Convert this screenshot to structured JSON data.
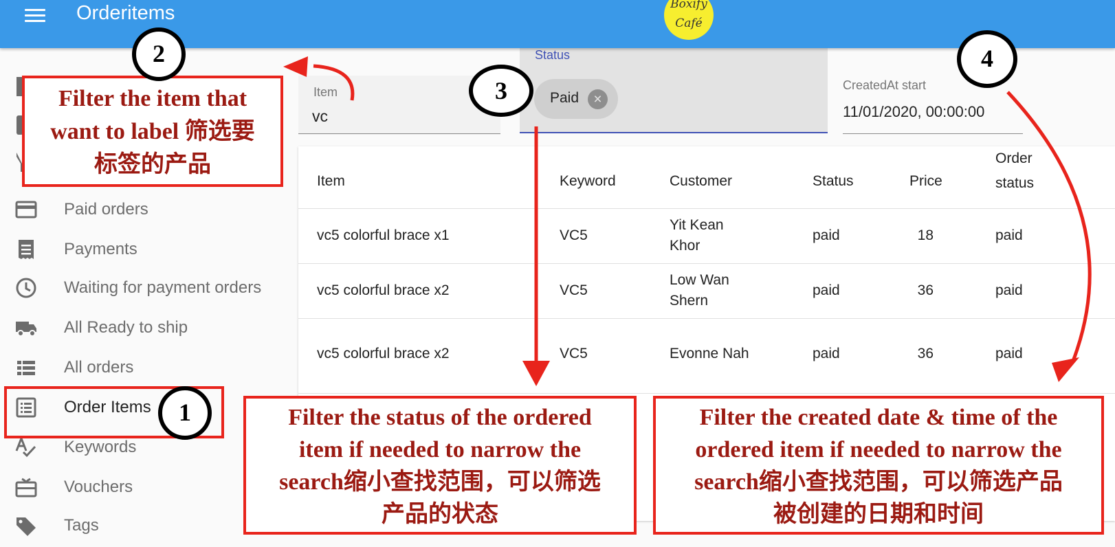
{
  "app": {
    "title": "Orderitems",
    "logo_line1": "Boxify",
    "logo_line2": "Café"
  },
  "sidebar": {
    "items": [
      {
        "label": "Paid orders",
        "icon": "credit-card-icon"
      },
      {
        "label": "Payments",
        "icon": "receipt-icon"
      },
      {
        "label": "Waiting for payment orders",
        "icon": "clock-icon"
      },
      {
        "label": "All Ready to ship",
        "icon": "truck-icon"
      },
      {
        "label": "All orders",
        "icon": "list-icon"
      },
      {
        "label": "Order Items",
        "icon": "list-box-icon"
      },
      {
        "label": "Keywords",
        "icon": "spellcheck-icon"
      },
      {
        "label": "Vouchers",
        "icon": "gift-card-icon"
      },
      {
        "label": "Tags",
        "icon": "tag-icon"
      }
    ]
  },
  "filters": {
    "item": {
      "label": "Item",
      "value": "vc"
    },
    "status": {
      "label": "Status",
      "chip": "Paid"
    },
    "created_at": {
      "label": "CreatedAt start",
      "value": "11/01/2020, 00:00:00"
    }
  },
  "table": {
    "headers": [
      "Item",
      "Keyword",
      "Customer",
      "Status",
      "Price",
      "Order status"
    ],
    "header_order_status_line1": "Order",
    "header_order_status_line2": "status",
    "rows": [
      {
        "item": "vc5 colorful brace x1",
        "keyword": "VC5",
        "customer_line1": "Yit Kean",
        "customer_line2": "Khor",
        "status": "paid",
        "price": "18",
        "order_status": "paid"
      },
      {
        "item": "vc5 colorful brace x2",
        "keyword": "VC5",
        "customer_line1": "Low Wan",
        "customer_line2": "Shern",
        "status": "paid",
        "price": "36",
        "order_status": "paid"
      },
      {
        "item": "vc5 colorful brace x2",
        "keyword": "VC5",
        "customer_line1": "Evonne Nah",
        "customer_line2": "",
        "status": "paid",
        "price": "36",
        "order_status": "paid"
      }
    ]
  },
  "annotations": {
    "badges": [
      "1",
      "2",
      "3",
      "4"
    ],
    "callout_item_line1": "Filter the item that",
    "callout_item_line2": "want to label 筛选要",
    "callout_item_line3": "标签的产品",
    "callout_status_line1": "Filter the status of the ordered",
    "callout_status_line2": "item if needed to narrow the",
    "callout_status_line3": "search缩小查找范围，可以筛选",
    "callout_status_line4": "产品的状态",
    "callout_date_line1": "Filter the created date & time of the",
    "callout_date_line2": "ordered item if needed to narrow the",
    "callout_date_line3": "search缩小查找范围，可以筛选产品",
    "callout_date_line4": "被创建的日期和时间",
    "color": "#e8241c",
    "text_color": "#9b1a12"
  },
  "colors": {
    "appbar": "#3a99e8",
    "logo": "#f7ee2f",
    "status_underline": "#3f51b5"
  }
}
